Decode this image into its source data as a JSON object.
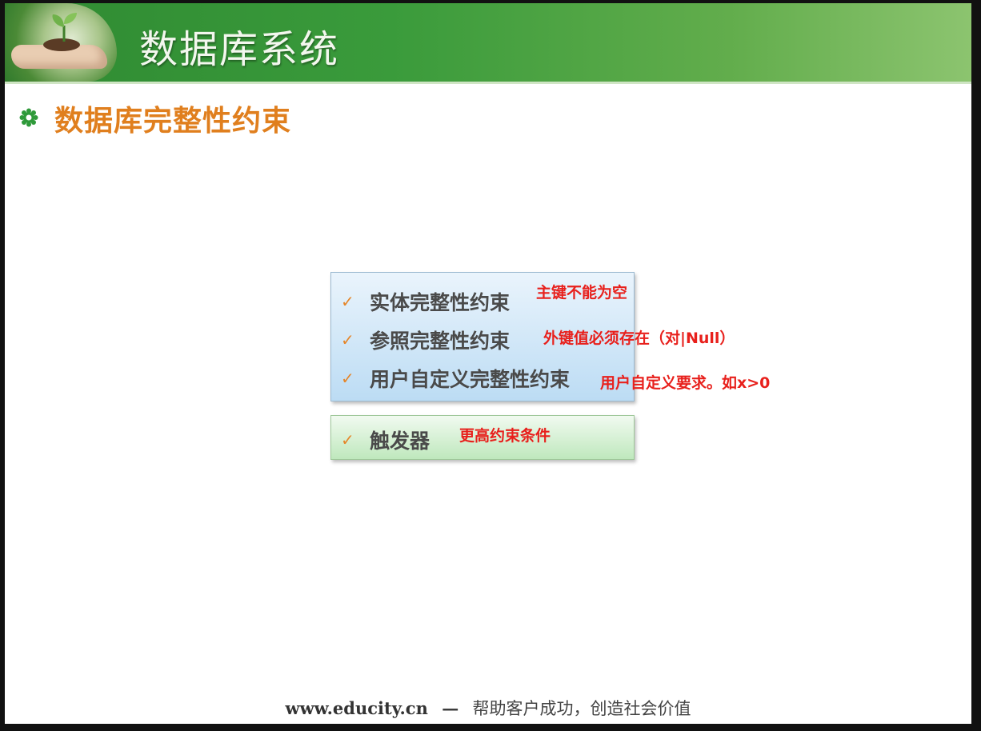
{
  "header": {
    "title": "数据库系统"
  },
  "section": {
    "title": "数据库完整性约束"
  },
  "constraints_box": {
    "items": [
      {
        "check": "✓",
        "label": "实体完整性约束"
      },
      {
        "check": "✓",
        "label": "参照完整性约束"
      },
      {
        "check": "✓",
        "label": "用户自定义完整性约束"
      }
    ]
  },
  "trigger_box": {
    "check": "✓",
    "label": "触发器"
  },
  "annotations": [
    {
      "text": "主键不能为空"
    },
    {
      "text": "外键值必须存在（对|Null）"
    },
    {
      "text": "用户自定义要求。如x>0"
    },
    {
      "text": "更高约束条件"
    }
  ],
  "footer": {
    "url": "www.educity.cn",
    "separator": "—",
    "slogan": "帮助客户成功，创造社会价值"
  },
  "colors": {
    "banner_green": "#3a9b3b",
    "section_title_orange": "#e07f1e",
    "check_orange": "#e5862a",
    "annotation_red": "#e8201c",
    "box_blue": "#bcdcf4",
    "box_green": "#bfe8bd"
  },
  "icons": {
    "logo": "sprout-in-hand-icon",
    "section_bullet": "gear-flower-icon"
  }
}
